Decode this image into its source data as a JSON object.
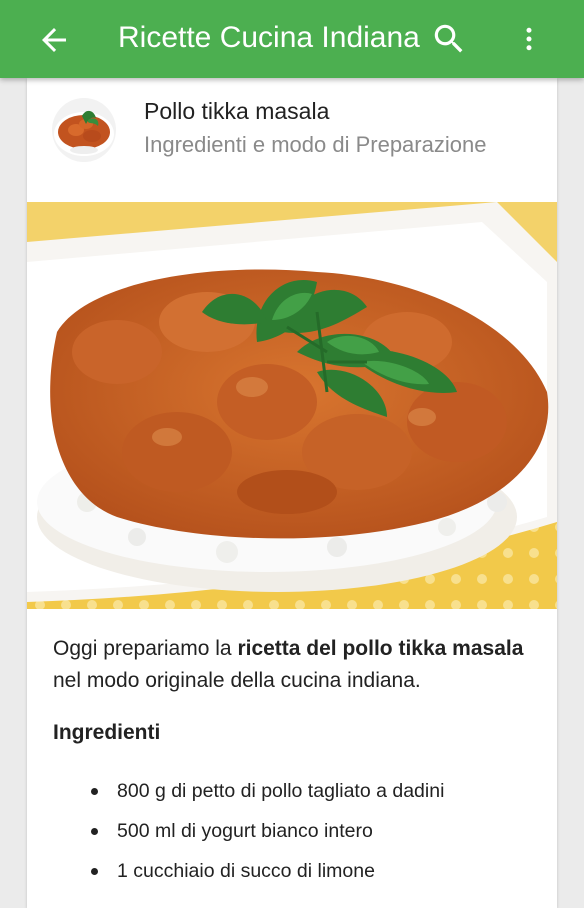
{
  "appbar": {
    "title": "Ricette Cucina Indiana",
    "back_icon": "arrow-back-icon",
    "search_icon": "search-icon",
    "more_icon": "more-vert-icon",
    "color": "#4caf50"
  },
  "recipe": {
    "title": "Pollo tikka masala",
    "subtitle": "Ingredienti e modo di Preparazione",
    "intro": {
      "before": "Oggi prepariamo la ",
      "bold": "ricetta del pollo tikka masala",
      "after": " nel modo originale della cucina indiana."
    },
    "ingredients_heading": "Ingredienti",
    "ingredients": [
      "800 g di petto di pollo tagliato a dadini",
      "500 ml di yogurt bianco intero",
      "1 cucchiaio di succo di limone"
    ]
  }
}
